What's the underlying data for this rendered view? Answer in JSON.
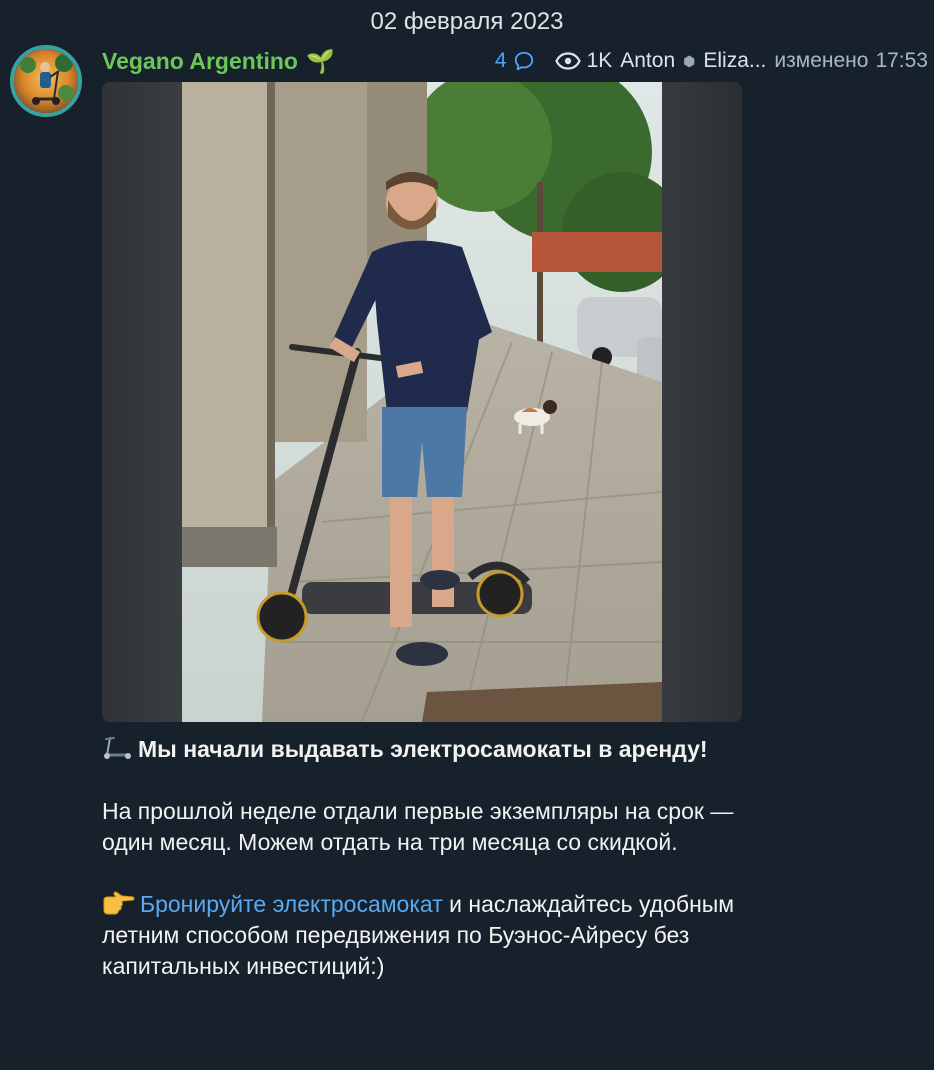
{
  "date_separator": "02 февраля 2023",
  "post": {
    "channel_name": "Vegano Argentino",
    "channel_suffix": "🌱",
    "comments_count": "4",
    "views": "1K",
    "author": "Anton",
    "coauthor": "Eliza...",
    "edited_label": "изменено",
    "time": "17:53",
    "headline": "Мы начали выдавать электросамокаты в аренду!",
    "paragraph1": "На прошлой неделе отдали первые экземпляры на срок — один месяц. Можем отдать на три месяца со скидкой.",
    "link_text": "Бронируйте электросамокат",
    "paragraph2_rest": " и наслаждайтесь удобным летним способом передвижения по Буэнос-Айресу без капитальных инвестиций:)"
  },
  "icons": {
    "headline_emoji": "kick-scooter-icon",
    "pointing_emoji": "pointing-right-icon",
    "comments": "comment-bubble-icon",
    "views": "eye-icon"
  },
  "colors": {
    "background": "#17212b",
    "channel_name": "#6cc75b",
    "link": "#5aa9f2",
    "comments": "#4fa3ff",
    "meta": "#a8b7c6"
  }
}
